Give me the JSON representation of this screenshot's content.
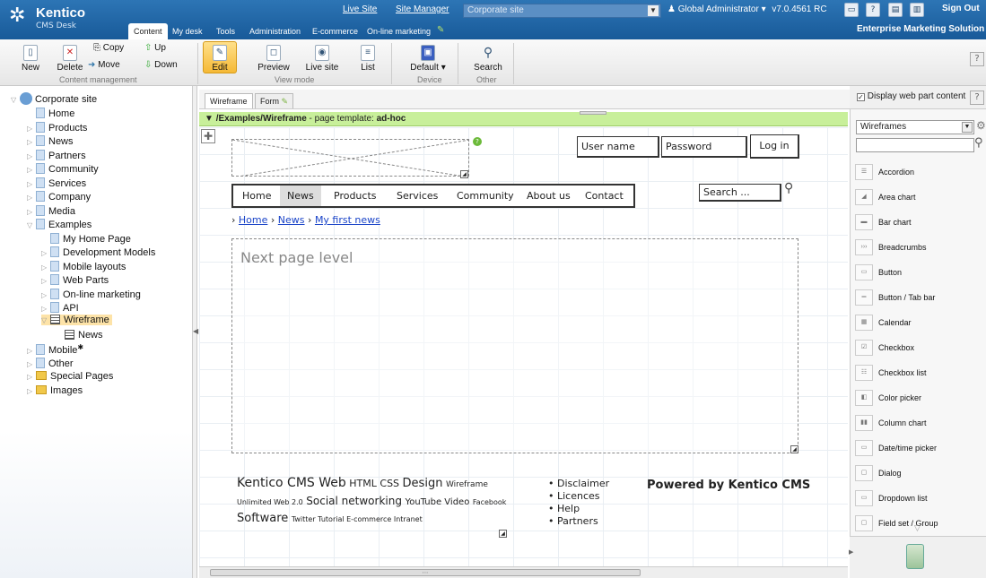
{
  "header": {
    "logo_name": "Kentico",
    "logo_sub": "CMS Desk",
    "tabs": [
      "Content",
      "My desk",
      "Tools",
      "Administration",
      "E-commerce",
      "On-line marketing"
    ],
    "live_site": "Live Site",
    "site_manager": "Site Manager",
    "site_select": "Corporate site",
    "user": "Global Administrator",
    "version": "v7.0.4561 RC",
    "sign_out": "Sign Out",
    "edition": "Enterprise Marketing Solution"
  },
  "toolbar": {
    "copy": "Copy",
    "up": "Up",
    "new": "New",
    "delete": "Delete",
    "move": "Move",
    "down": "Down",
    "group1": "Content management",
    "edit": "Edit",
    "preview": "Preview",
    "live_site": "Live site",
    "list": "List",
    "group2": "View mode",
    "default": "Default",
    "group3": "Device",
    "search": "Search",
    "group4": "Other"
  },
  "tree": [
    {
      "label": "Corporate site"
    },
    {
      "label": "Home"
    },
    {
      "label": "Products"
    },
    {
      "label": "News"
    },
    {
      "label": "Partners"
    },
    {
      "label": "Community"
    },
    {
      "label": "Services"
    },
    {
      "label": "Company"
    },
    {
      "label": "Media"
    },
    {
      "label": "Examples"
    },
    {
      "label": "My Home Page"
    },
    {
      "label": "Development Models"
    },
    {
      "label": "Mobile layouts"
    },
    {
      "label": "Web Parts"
    },
    {
      "label": "On-line marketing"
    },
    {
      "label": "API"
    },
    {
      "label": "Wireframe"
    },
    {
      "label": "News"
    },
    {
      "label": "Mobile"
    },
    {
      "label": "Other"
    },
    {
      "label": "Special Pages"
    },
    {
      "label": "Images"
    }
  ],
  "center": {
    "tab_wireframe": "Wireframe",
    "tab_form": "Form",
    "path": "/Examples/Wireframe",
    "template_text": " - page template: ",
    "template_name": "ad-hoc"
  },
  "wireframe": {
    "username": "User name",
    "password": "Password",
    "login": "Log in",
    "menu": [
      "Home",
      "News",
      "Products",
      "Services",
      "Community",
      "About us",
      "Contact"
    ],
    "search": "Search ...",
    "breadcrumbs": [
      "Home",
      "News",
      "My first news"
    ],
    "next_level": "Next page level",
    "tags": {
      "t1": "Kentico CMS Web",
      "t2": "HTML CSS",
      "t3": "Design",
      "t4": "Wireframe",
      "t5": "Unlimited Web 2.0",
      "t6": "Social networking",
      "t7": "YouTube Video",
      "t8": "Facebook",
      "t9": "Software",
      "t10": "Twitter Tutorial E-commerce Intranet"
    },
    "footer_links": [
      "Disclaimer",
      "Licences",
      "Help",
      "Partners"
    ],
    "powered": "Powered by Kentico CMS"
  },
  "right_panel": {
    "display_label": "Display web part content",
    "category": "Wireframes",
    "items": [
      "Accordion",
      "Area chart",
      "Bar chart",
      "Breadcrumbs",
      "Button",
      "Button / Tab bar",
      "Calendar",
      "Checkbox",
      "Checkbox list",
      "Color picker",
      "Column chart",
      "Date/time picker",
      "Dialog",
      "Dropdown list",
      "Field set / Group"
    ]
  }
}
